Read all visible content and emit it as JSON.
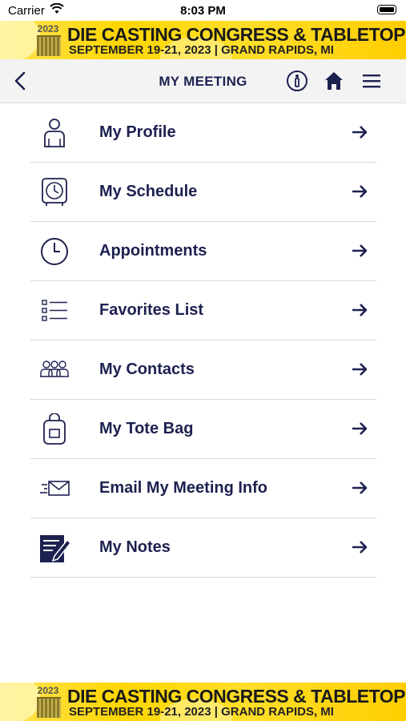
{
  "status_bar": {
    "carrier": "Carrier",
    "time": "8:03 PM"
  },
  "banner": {
    "year": "2023",
    "title": "DIE CASTING CONGRESS & TABLETOP",
    "subtitle": "SEPTEMBER 19-21, 2023 | GRAND RAPIDS, MI"
  },
  "nav": {
    "title": "MY MEETING"
  },
  "menu": {
    "items": [
      {
        "label": "My Profile",
        "icon": "person-icon"
      },
      {
        "label": "My Schedule",
        "icon": "clock-schedule-icon"
      },
      {
        "label": "Appointments",
        "icon": "clock-icon"
      },
      {
        "label": "Favorites List",
        "icon": "checklist-icon"
      },
      {
        "label": "My Contacts",
        "icon": "group-icon"
      },
      {
        "label": "My Tote Bag",
        "icon": "tote-bag-icon"
      },
      {
        "label": "Email My Meeting Info",
        "icon": "envelope-icon"
      },
      {
        "label": "My Notes",
        "icon": "notes-icon"
      }
    ]
  },
  "colors": {
    "primary": "#1d2150",
    "banner": "#ffd600",
    "navbar_bg": "#f3f3f4"
  }
}
